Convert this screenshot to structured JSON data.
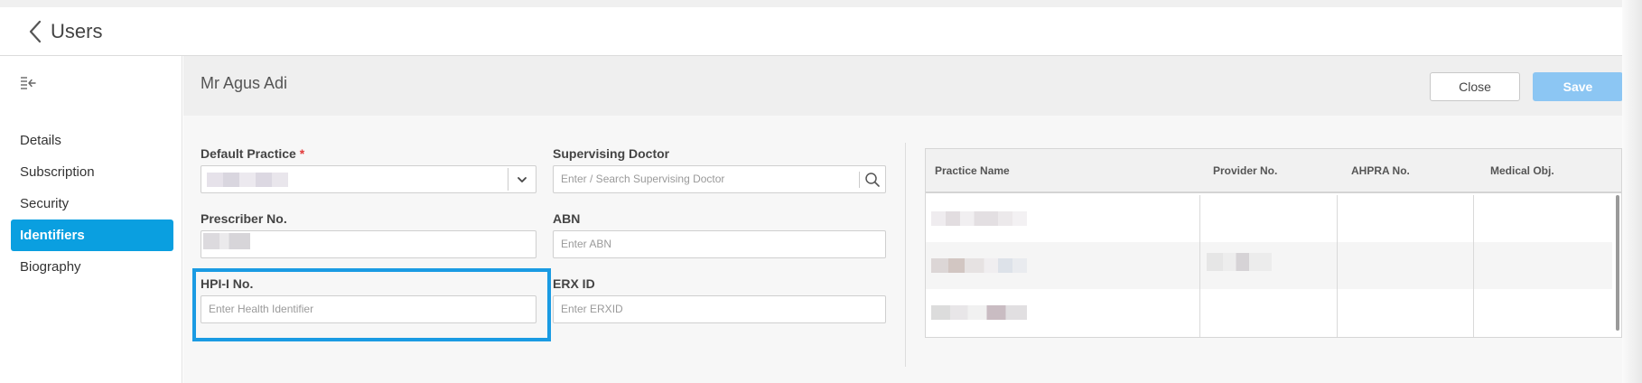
{
  "header": {
    "title": "Users",
    "back_icon": "chevron-left-icon"
  },
  "sidebar": {
    "collapse_icon": "collapse-menu-icon",
    "items": [
      {
        "label": "Details",
        "active": false
      },
      {
        "label": "Subscription",
        "active": false
      },
      {
        "label": "Security",
        "active": false
      },
      {
        "label": "Identifiers",
        "active": true
      },
      {
        "label": "Biography",
        "active": false
      }
    ]
  },
  "main": {
    "name": "Mr Agus Adi",
    "close_label": "Close",
    "save_label": "Save"
  },
  "form": {
    "default_practice": {
      "label": "Default Practice",
      "required_mark": "*"
    },
    "supervising_doctor": {
      "label": "Supervising Doctor",
      "placeholder": "Enter / Search Supervising Doctor"
    },
    "prescriber_no": {
      "label": "Prescriber No."
    },
    "abn": {
      "label": "ABN",
      "placeholder": "Enter ABN"
    },
    "hpii": {
      "label": "HPI-I No.",
      "placeholder": "Enter Health Identifier"
    },
    "erx": {
      "label": "ERX ID",
      "placeholder": "Enter ERXID"
    }
  },
  "table": {
    "columns": [
      "Practice Name",
      "Provider No.",
      "AHPRA No.",
      "Medical Obj."
    ]
  },
  "colors": {
    "accent": "#0a9fe0",
    "save": "#8cc6f3",
    "highlight": "#1a9be3",
    "required": "#e23b3b"
  }
}
